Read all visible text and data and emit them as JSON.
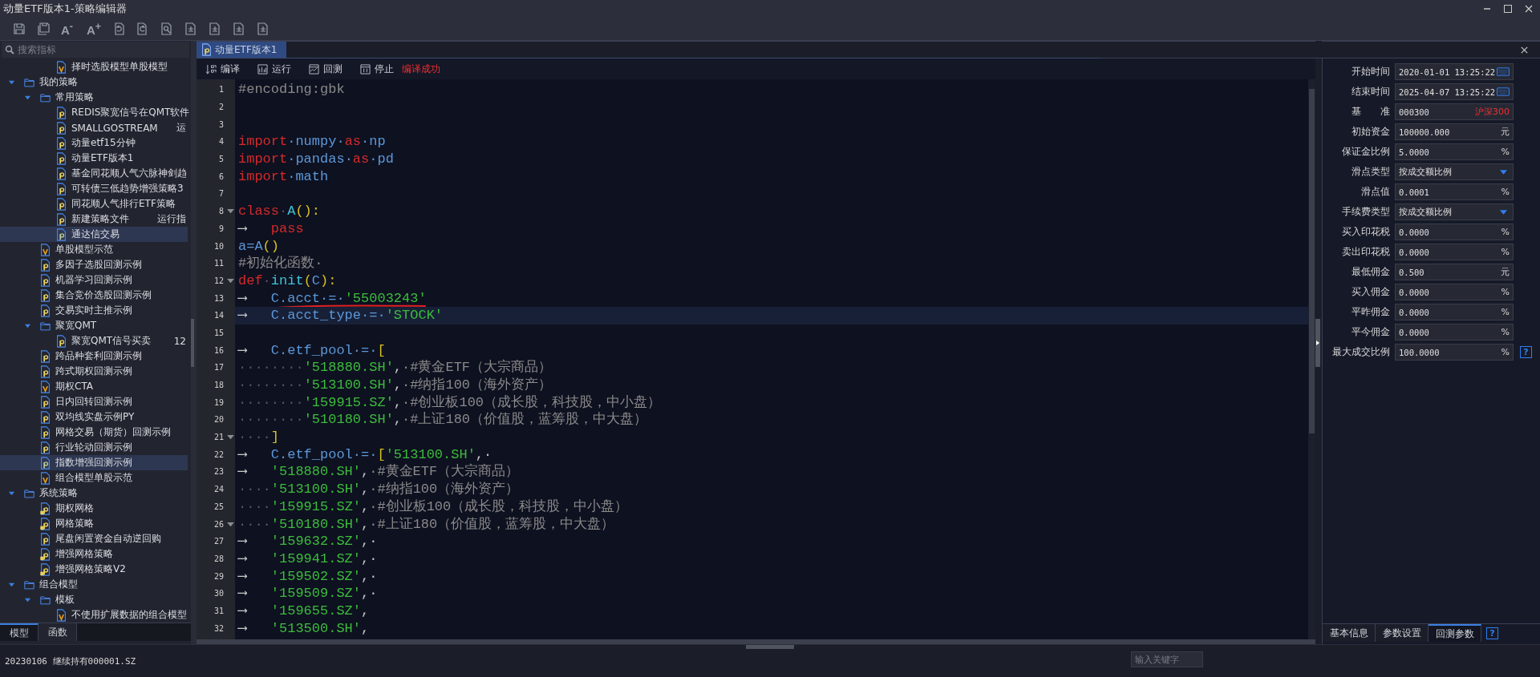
{
  "window": {
    "title": "动量ETF版本1-策略编辑器"
  },
  "toolbar": [
    {
      "kind": "save"
    },
    {
      "kind": "save-all"
    },
    {
      "kind": "text",
      "text": "A$^{-}$"
    },
    {
      "kind": "text",
      "text": "A$^{+}$"
    },
    {
      "kind": "undo"
    },
    {
      "kind": "redo"
    },
    {
      "kind": "find"
    },
    {
      "kind": "doc"
    },
    {
      "kind": "doc"
    },
    {
      "kind": "doc"
    },
    {
      "kind": "doc"
    }
  ],
  "sidebar": {
    "search": {
      "placeholder": "搜索指标"
    },
    "continued": [
      {
        "label": "择时选股模型单股模型",
        "kind": "v",
        "selected": false
      }
    ],
    "tree": [
      {
        "label": "我的策略",
        "kind": "folder",
        "expanded": true,
        "children": [
          {
            "label": "常用策略",
            "kind": "folder",
            "expanded": true,
            "children": [
              {
                "label": "REDIS聚宽信号在QMT软件",
                "kind": "p",
                "selected": false
              },
              {
                "label": "SMALLGOSTREAM",
                "kind": "p",
                "selected": false,
                "note": "运"
              },
              {
                "label": "动量etf15分钟",
                "kind": "p",
                "selected": false
              },
              {
                "label": "动量ETF版本1",
                "kind": "p",
                "selected": false
              },
              {
                "label": "基金同花顺人气六脉神剑趋",
                "kind": "p",
                "selected": false
              },
              {
                "label": "可转债三低趋势增强策略3",
                "kind": "p",
                "selected": false
              },
              {
                "label": "同花顺人气排行ETF策略",
                "kind": "p",
                "selected": false
              },
              {
                "label": "新建策略文件",
                "kind": "p",
                "selected": false,
                "note": "运行指"
              },
              {
                "label": "通达信交易",
                "kind": "p",
                "selected": true
              }
            ]
          },
          {
            "label": "单股模型示范",
            "kind": "v",
            "selected": false
          },
          {
            "label": "多因子选股回测示例",
            "kind": "p",
            "selected": false
          },
          {
            "label": "机器学习回测示例",
            "kind": "p",
            "selected": false
          },
          {
            "label": "集合竞价选股回测示例",
            "kind": "p",
            "selected": false
          },
          {
            "label": "交易实时主推示例",
            "kind": "p",
            "selected": false
          },
          {
            "label": "聚宽QMT",
            "kind": "folder",
            "expanded": true,
            "children": [
              {
                "label": "聚宽QMT信号买卖",
                "kind": "p",
                "selected": false,
                "note": "12"
              }
            ]
          },
          {
            "label": "跨品种套利回测示例",
            "kind": "p",
            "selected": false
          },
          {
            "label": "跨式期权回测示例",
            "kind": "p",
            "selected": false
          },
          {
            "label": "期权CTA",
            "kind": "v",
            "selected": false
          },
          {
            "label": "日内回转回测示例",
            "kind": "p",
            "selected": false
          },
          {
            "label": "双均线实盘示例PY",
            "kind": "p",
            "selected": false
          },
          {
            "label": "网格交易（期货）回测示例",
            "kind": "p",
            "selected": false
          },
          {
            "label": "行业轮动回测示例",
            "kind": "p",
            "selected": false
          },
          {
            "label": "指数增强回测示例",
            "kind": "p",
            "selected": true
          },
          {
            "label": "组合模型单股示范",
            "kind": "v",
            "selected": false
          }
        ]
      },
      {
        "label": "系统策略",
        "kind": "folder",
        "expanded": true,
        "children": [
          {
            "label": "期权网格",
            "kind": "plock",
            "selected": false
          },
          {
            "label": "网格策略",
            "kind": "plock",
            "selected": false
          },
          {
            "label": "尾盘闲置资金自动逆回购",
            "kind": "p",
            "selected": false
          },
          {
            "label": "增强网格策略",
            "kind": "plock",
            "selected": false
          },
          {
            "label": "增强网格策略V2",
            "kind": "plock",
            "selected": false
          }
        ]
      },
      {
        "label": "组合模型",
        "kind": "folder",
        "expanded": true,
        "children": [
          {
            "label": "模板",
            "kind": "folder",
            "expanded": true,
            "children": [
              {
                "label": "不使用扩展数据的组合模型",
                "kind": "v",
                "selected": false
              }
            ]
          }
        ]
      }
    ],
    "tabs": [
      {
        "label": "模型",
        "selected": true
      },
      {
        "label": "函数",
        "selected": false
      }
    ]
  },
  "editor": {
    "tabs": [
      {
        "label": "动量ETF版本1",
        "selected": true
      }
    ],
    "actions": [
      {
        "kind": "compile",
        "label": "编译"
      },
      {
        "kind": "run",
        "label": "运行"
      },
      {
        "kind": "backtest",
        "label": "回测"
      },
      {
        "kind": "stop",
        "label": "停止"
      }
    ],
    "status": "编译成功",
    "lines": [
      {
        "number": "1",
        "tokens": [
          {
            "kind": "comment",
            "text": "#encoding:gbk"
          }
        ]
      },
      {
        "number": "2"
      },
      {
        "number": "3"
      },
      {
        "number": "4",
        "tokens": [
          {
            "kind": "keyword",
            "text": "import"
          },
          {
            "kind": "name",
            "text": "·numpy·"
          },
          {
            "kind": "keyword",
            "text": "as"
          },
          {
            "kind": "name",
            "text": "·np"
          }
        ]
      },
      {
        "number": "5",
        "tokens": [
          {
            "kind": "keyword",
            "text": "import"
          },
          {
            "kind": "name",
            "text": "·pandas·"
          },
          {
            "kind": "keyword",
            "text": "as"
          },
          {
            "kind": "name",
            "text": "·pd"
          }
        ]
      },
      {
        "number": "6",
        "tokens": [
          {
            "kind": "keyword",
            "text": "import"
          },
          {
            "kind": "name",
            "text": "·math"
          }
        ]
      },
      {
        "number": "7"
      },
      {
        "number": "8",
        "fold": true,
        "tokens": [
          {
            "kind": "keyword",
            "text": "class"
          },
          {
            "kind": "space",
            "text": "·"
          },
          {
            "kind": "class",
            "text": "A"
          },
          {
            "kind": "punct",
            "text": "():"
          }
        ]
      },
      {
        "number": "9",
        "tokens": [
          {
            "kind": "tab",
            "text": "⟶"
          },
          {
            "kind": "keyword",
            "text": "pass"
          }
        ]
      },
      {
        "number": "10",
        "tokens": [
          {
            "kind": "name",
            "text": "a=A"
          },
          {
            "kind": "punct",
            "text": "()"
          }
        ]
      },
      {
        "number": "11",
        "tokens": [
          {
            "kind": "comment",
            "text": "#初始化函数·"
          }
        ]
      },
      {
        "number": "12",
        "fold": true,
        "tokens": [
          {
            "kind": "keyword",
            "text": "def"
          },
          {
            "kind": "space",
            "text": "·"
          },
          {
            "kind": "class",
            "text": "init"
          },
          {
            "kind": "punct",
            "text": "("
          },
          {
            "kind": "name",
            "text": "C"
          },
          {
            "kind": "punct",
            "text": "):"
          }
        ]
      },
      {
        "number": "13",
        "underlined": true,
        "tokens": [
          {
            "kind": "tab",
            "text": "⟶"
          },
          {
            "kind": "name",
            "text": "C.acct·=·"
          },
          {
            "kind": "string",
            "text": "'55003243'"
          }
        ]
      },
      {
        "number": "14",
        "highlighted": true,
        "tokens": [
          {
            "kind": "tab",
            "text": "⟶"
          },
          {
            "kind": "name",
            "text": "C.acct_type·=·"
          },
          {
            "kind": "string",
            "text": "'STOCK'"
          }
        ]
      },
      {
        "number": "15"
      },
      {
        "number": "16",
        "tokens": [
          {
            "kind": "tab",
            "text": "⟶"
          },
          {
            "kind": "name",
            "text": "C.etf_pool·=·"
          },
          {
            "kind": "punct",
            "text": "["
          }
        ]
      },
      {
        "number": "17",
        "tokens": [
          {
            "kind": "space",
            "text": "········"
          },
          {
            "kind": "string",
            "text": "'518880.SH'"
          },
          {
            "kind": "plain",
            "text": ","
          },
          {
            "kind": "comment",
            "text": "·#黄金ETF（大宗商品）"
          }
        ]
      },
      {
        "number": "18",
        "tokens": [
          {
            "kind": "space",
            "text": "········"
          },
          {
            "kind": "string",
            "text": "'513100.SH'"
          },
          {
            "kind": "plain",
            "text": ","
          },
          {
            "kind": "comment",
            "text": "·#纳指100（海外资产）"
          }
        ]
      },
      {
        "number": "19",
        "tokens": [
          {
            "kind": "space",
            "text": "········"
          },
          {
            "kind": "string",
            "text": "'159915.SZ'"
          },
          {
            "kind": "plain",
            "text": ","
          },
          {
            "kind": "comment",
            "text": "·#创业板100（成长股，科技股，中小盘）"
          }
        ]
      },
      {
        "number": "20",
        "tokens": [
          {
            "kind": "space",
            "text": "········"
          },
          {
            "kind": "string",
            "text": "'510180.SH'"
          },
          {
            "kind": "plain",
            "text": ","
          },
          {
            "kind": "comment",
            "text": "·#上证180（价值股，蓝筹股，中大盘）"
          }
        ]
      },
      {
        "number": "21",
        "fold": true,
        "tokens": [
          {
            "kind": "space",
            "text": "····"
          },
          {
            "kind": "punct",
            "text": "]"
          }
        ]
      },
      {
        "number": "22",
        "tokens": [
          {
            "kind": "tab",
            "text": "⟶"
          },
          {
            "kind": "name",
            "text": "C.etf_pool·=·"
          },
          {
            "kind": "punct",
            "text": "["
          },
          {
            "kind": "string",
            "text": "'513100.SH'"
          },
          {
            "kind": "plain",
            "text": ",·"
          }
        ]
      },
      {
        "number": "23",
        "tokens": [
          {
            "kind": "tab",
            "text": "⟶"
          },
          {
            "kind": "string",
            "text": "'518880.SH'"
          },
          {
            "kind": "plain",
            "text": ","
          },
          {
            "kind": "comment",
            "text": "·#黄金ETF（大宗商品）"
          }
        ]
      },
      {
        "number": "24",
        "tokens": [
          {
            "kind": "space",
            "text": "····"
          },
          {
            "kind": "string",
            "text": "'513100.SH'"
          },
          {
            "kind": "plain",
            "text": ","
          },
          {
            "kind": "comment",
            "text": "·#纳指100（海外资产）"
          }
        ]
      },
      {
        "number": "25",
        "tokens": [
          {
            "kind": "space",
            "text": "····"
          },
          {
            "kind": "string",
            "text": "'159915.SZ'"
          },
          {
            "kind": "plain",
            "text": ","
          },
          {
            "kind": "comment",
            "text": "·#创业板100（成长股，科技股，中小盘）"
          }
        ]
      },
      {
        "number": "26",
        "fold": true,
        "tokens": [
          {
            "kind": "space",
            "text": "····"
          },
          {
            "kind": "string",
            "text": "'510180.SH'"
          },
          {
            "kind": "plain",
            "text": ","
          },
          {
            "kind": "comment",
            "text": "·#上证180（价值股，蓝筹股，中大盘）"
          }
        ]
      },
      {
        "number": "27",
        "tokens": [
          {
            "kind": "tab",
            "text": "⟶"
          },
          {
            "kind": "string",
            "text": "'159632.SZ'"
          },
          {
            "kind": "plain",
            "text": ",·"
          }
        ]
      },
      {
        "number": "28",
        "tokens": [
          {
            "kind": "tab",
            "text": "⟶"
          },
          {
            "kind": "string",
            "text": "'159941.SZ'"
          },
          {
            "kind": "plain",
            "text": ",·"
          }
        ]
      },
      {
        "number": "29",
        "tokens": [
          {
            "kind": "tab",
            "text": "⟶"
          },
          {
            "kind": "string",
            "text": "'159502.SZ'"
          },
          {
            "kind": "plain",
            "text": ",·"
          }
        ]
      },
      {
        "number": "30",
        "tokens": [
          {
            "kind": "tab",
            "text": "⟶"
          },
          {
            "kind": "string",
            "text": "'159509.SZ'"
          },
          {
            "kind": "plain",
            "text": ",·"
          }
        ]
      },
      {
        "number": "31",
        "tokens": [
          {
            "kind": "tab",
            "text": "⟶"
          },
          {
            "kind": "string",
            "text": "'159655.SZ'"
          },
          {
            "kind": "plain",
            "text": ","
          }
        ]
      },
      {
        "number": "32",
        "tokens": [
          {
            "kind": "tab",
            "text": "⟶"
          },
          {
            "kind": "string",
            "text": "'513500.SH'"
          },
          {
            "kind": "plain",
            "text": ","
          }
        ]
      }
    ]
  },
  "settings": {
    "rows": [
      {
        "label": "开始时间",
        "value": "2020-01-01 13:25:22",
        "kind": "date"
      },
      {
        "label": "结束时间",
        "value": "2025-04-07 13:25:22",
        "kind": "date"
      },
      {
        "label": "基　　准",
        "value": "000300",
        "kind": "benchmark",
        "suffix": "沪深300"
      },
      {
        "label": "初始资金",
        "value": "100000.000",
        "kind": "unit",
        "suffix": "元"
      },
      {
        "label": "保证金比例",
        "value": "5.0000",
        "kind": "unit",
        "suffix": "%"
      },
      {
        "label": "滑点类型",
        "value": "按成交额比例",
        "kind": "select"
      },
      {
        "label": "滑点值",
        "value": "0.0001",
        "kind": "unit",
        "suffix": "%"
      },
      {
        "label": "手续费类型",
        "value": "按成交额比例",
        "kind": "select"
      },
      {
        "label": "买入印花税",
        "value": "0.0000",
        "kind": "unit",
        "suffix": "%"
      },
      {
        "label": "卖出印花税",
        "value": "0.0000",
        "kind": "unit",
        "suffix": "%"
      },
      {
        "label": "最低佣金",
        "value": "0.500",
        "kind": "unit",
        "suffix": "元"
      },
      {
        "label": "买入佣金",
        "value": "0.0000",
        "kind": "unit",
        "suffix": "%"
      },
      {
        "label": "平昨佣金",
        "value": "0.0000",
        "kind": "unit",
        "suffix": "%"
      },
      {
        "label": "平今佣金",
        "value": "0.0000",
        "kind": "unit",
        "suffix": "%"
      },
      {
        "label": "最大成交比例",
        "value": "100.0000",
        "kind": "unit",
        "suffix": "%",
        "help": "?"
      }
    ],
    "tabs": [
      {
        "label": "基本信息",
        "selected": false
      },
      {
        "label": "参数设置",
        "selected": false
      },
      {
        "label": "回测参数",
        "selected": true
      }
    ],
    "help": "?"
  },
  "status_bar": {
    "message": "20230106 继续持有000001.SZ",
    "search": {
      "placeholder": "输入关键字"
    }
  }
}
